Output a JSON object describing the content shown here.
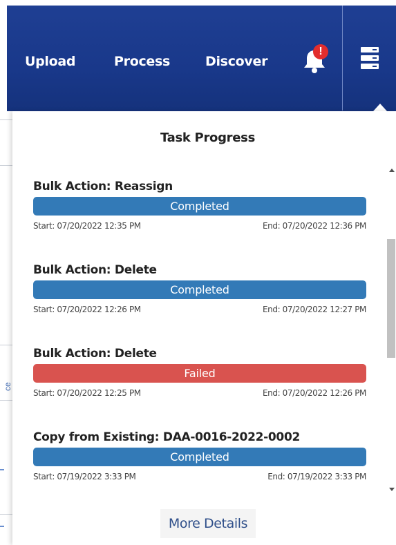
{
  "nav": {
    "links": [
      "Upload",
      "Process",
      "Discover"
    ],
    "alert_badge": "!",
    "bell_icon": "bell-icon",
    "menu_icon": "server-stack-icon"
  },
  "panel": {
    "title": "Task Progress",
    "tasks": [
      {
        "title": "Bulk Action: Reassign",
        "status": "Completed",
        "progress": 1.0,
        "start": "Start: 07/20/2022 12:35 PM",
        "end": "End: 07/20/2022 12:36 PM"
      },
      {
        "title": "Bulk Action: Delete",
        "status": "Completed",
        "progress": 1.0,
        "start": "Start: 07/20/2022 12:26 PM",
        "end": "End: 07/20/2022 12:27 PM"
      },
      {
        "title": "Bulk Action: Delete",
        "status": "Failed",
        "progress": 1.0,
        "start": "Start: 07/20/2022 12:25 PM",
        "end": "End: 07/20/2022 12:26 PM"
      },
      {
        "title": "Copy from Existing: DAA-0016-2022-0002",
        "status": "Completed",
        "progress": 1.0,
        "start": "Start: 07/19/2022 3:33 PM",
        "end": "End: 07/19/2022 3:33 PM"
      }
    ],
    "more_details": "More Details"
  },
  "background": {
    "fragment": "ce"
  },
  "colors": {
    "navbar": "#1f3f93",
    "completed": "#337ab7",
    "failed": "#d9534f",
    "badge": "#e22d2d"
  }
}
